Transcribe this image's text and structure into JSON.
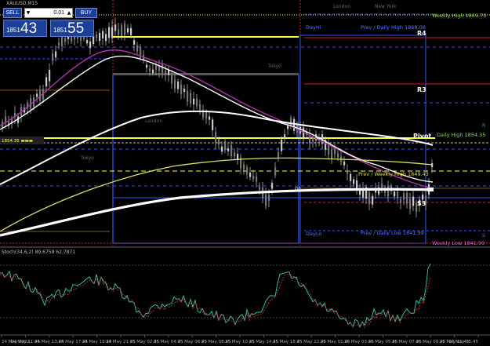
{
  "symbol": "XAUUSD,M15",
  "trade_panel": {
    "sell_label": "SELL",
    "buy_label": "BUY",
    "lot_value": "0.01",
    "sell_price_small": "1851",
    "sell_price_big": "43",
    "buy_price_small": "1851",
    "buy_price_big": "55"
  },
  "session_labels": {
    "london": "London",
    "newyork": "New York",
    "tokyo": "Tokyo"
  },
  "levels": {
    "weekly_high": "Weekly High 1869.70",
    "prev_daily_high": "Prev / Daily High 1868.08",
    "day_hi": "DayHi",
    "r4": "R4",
    "r3": "R3",
    "pivot": "Pivot",
    "daily_high": "Daily High 1854.35",
    "prev_weekly_high": "Prev / Weekly High 1849.43",
    "s3": "S3",
    "day_lo": "DayLo",
    "prev_daily_low": "Prev / Daily Low 1841.99",
    "weekly_low": "Weekly Low 1841.99",
    "d1": "D1",
    "r_right": "R",
    "s_right": "S"
  },
  "indicator_label": "Stoch(34,6,2) 89.6758 62.7871",
  "time_axis": [
    "24 May 2022",
    "24 May 11:45",
    "24 May 13:45",
    "24 May 17:45",
    "24 May 19:45",
    "24 May 21:45",
    "25 May 02:45",
    "25 May 04:45",
    "25 May 06:45",
    "25 May 08:45",
    "25 May 10:45",
    "25 May 14:45",
    "25 May 18:45",
    "25 May 22:45",
    "26 May 01:45",
    "26 May 03:45",
    "26 May 05:45",
    "26 May 07:45",
    "26 May 09:45",
    "26 May 11:45",
    "26 May 15:45"
  ],
  "colors": {
    "background": "#000000",
    "yellow": "#ffff44",
    "blue": "#3355ff",
    "red": "#cc2222",
    "white": "#ffffff",
    "magenta": "#aa33aa",
    "candle": "#c8c8c8",
    "green_text": "#88dd44",
    "teal": "#33ccaa"
  }
}
